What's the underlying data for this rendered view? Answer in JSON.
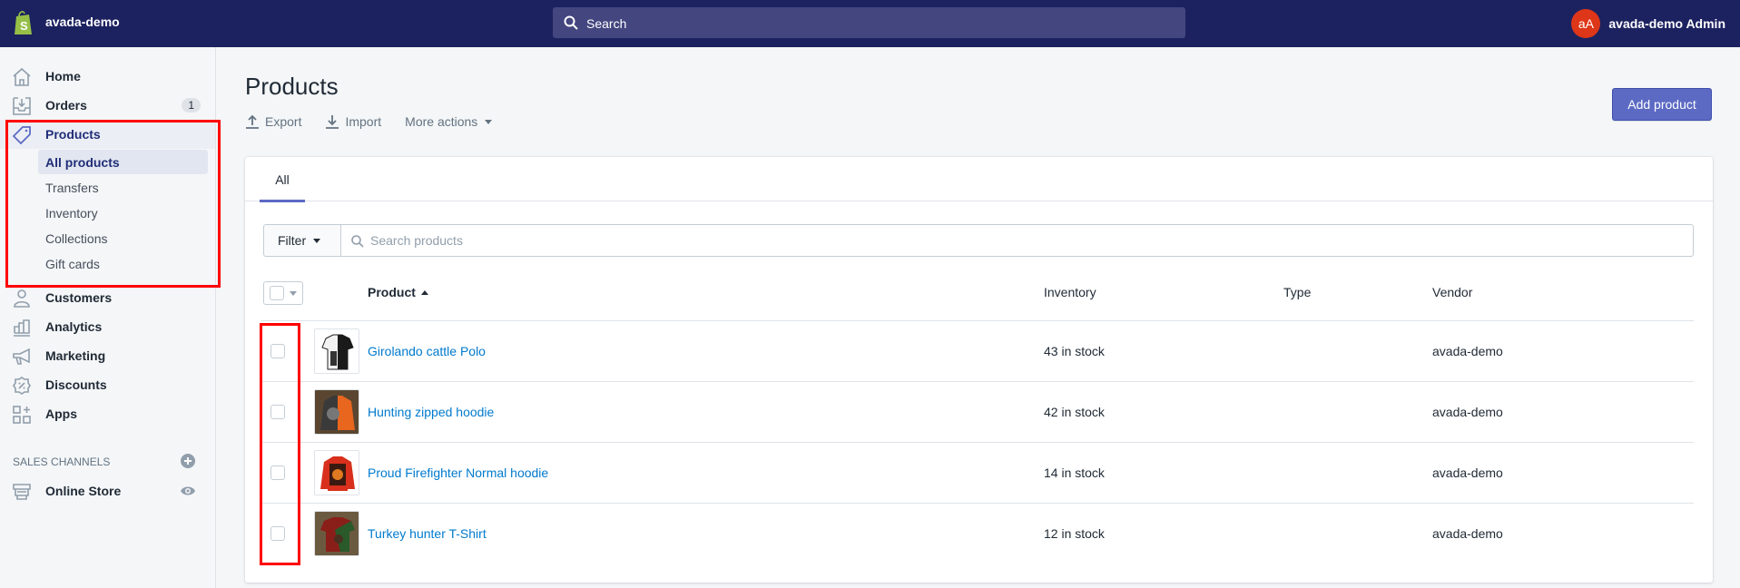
{
  "topbar": {
    "store_name": "avada-demo",
    "search_placeholder": "Search",
    "user_initials": "aA",
    "user_name": "avada-demo Admin",
    "brand_color": "#1c2260",
    "avatar_color": "#de3618"
  },
  "sidebar": {
    "items": [
      {
        "label": "Home",
        "icon": "home-icon"
      },
      {
        "label": "Orders",
        "icon": "orders-icon",
        "badge": "1"
      },
      {
        "label": "Products",
        "icon": "tag-icon",
        "active": true
      },
      {
        "label": "Customers",
        "icon": "person-icon"
      },
      {
        "label": "Analytics",
        "icon": "bar-chart-icon"
      },
      {
        "label": "Marketing",
        "icon": "megaphone-icon"
      },
      {
        "label": "Discounts",
        "icon": "discount-icon"
      },
      {
        "label": "Apps",
        "icon": "apps-icon"
      }
    ],
    "product_subitems": [
      {
        "label": "All products",
        "active": true
      },
      {
        "label": "Transfers"
      },
      {
        "label": "Inventory"
      },
      {
        "label": "Collections"
      },
      {
        "label": "Gift cards"
      }
    ],
    "sales_channels_heading": "SALES CHANNELS",
    "online_store_label": "Online Store"
  },
  "page": {
    "title": "Products",
    "actions": {
      "export": "Export",
      "import": "Import",
      "more": "More actions"
    },
    "add_product_label": "Add product",
    "accent_color": "#5c6ac4"
  },
  "card": {
    "tabs": [
      {
        "label": "All",
        "selected": true
      }
    ],
    "filter_label": "Filter",
    "search_placeholder": "Search products",
    "columns": {
      "product": "Product",
      "inventory": "Inventory",
      "type": "Type",
      "vendor": "Vendor"
    },
    "rows": [
      {
        "name": "Girolando cattle Polo",
        "inventory": "43 in stock",
        "type": "",
        "vendor": "avada-demo"
      },
      {
        "name": "Hunting zipped hoodie",
        "inventory": "42 in stock",
        "type": "",
        "vendor": "avada-demo"
      },
      {
        "name": "Proud Firefighter Normal hoodie",
        "inventory": "14 in stock",
        "type": "",
        "vendor": "avada-demo"
      },
      {
        "name": "Turkey hunter T-Shirt",
        "inventory": "12 in stock",
        "type": "",
        "vendor": "avada-demo"
      }
    ]
  }
}
